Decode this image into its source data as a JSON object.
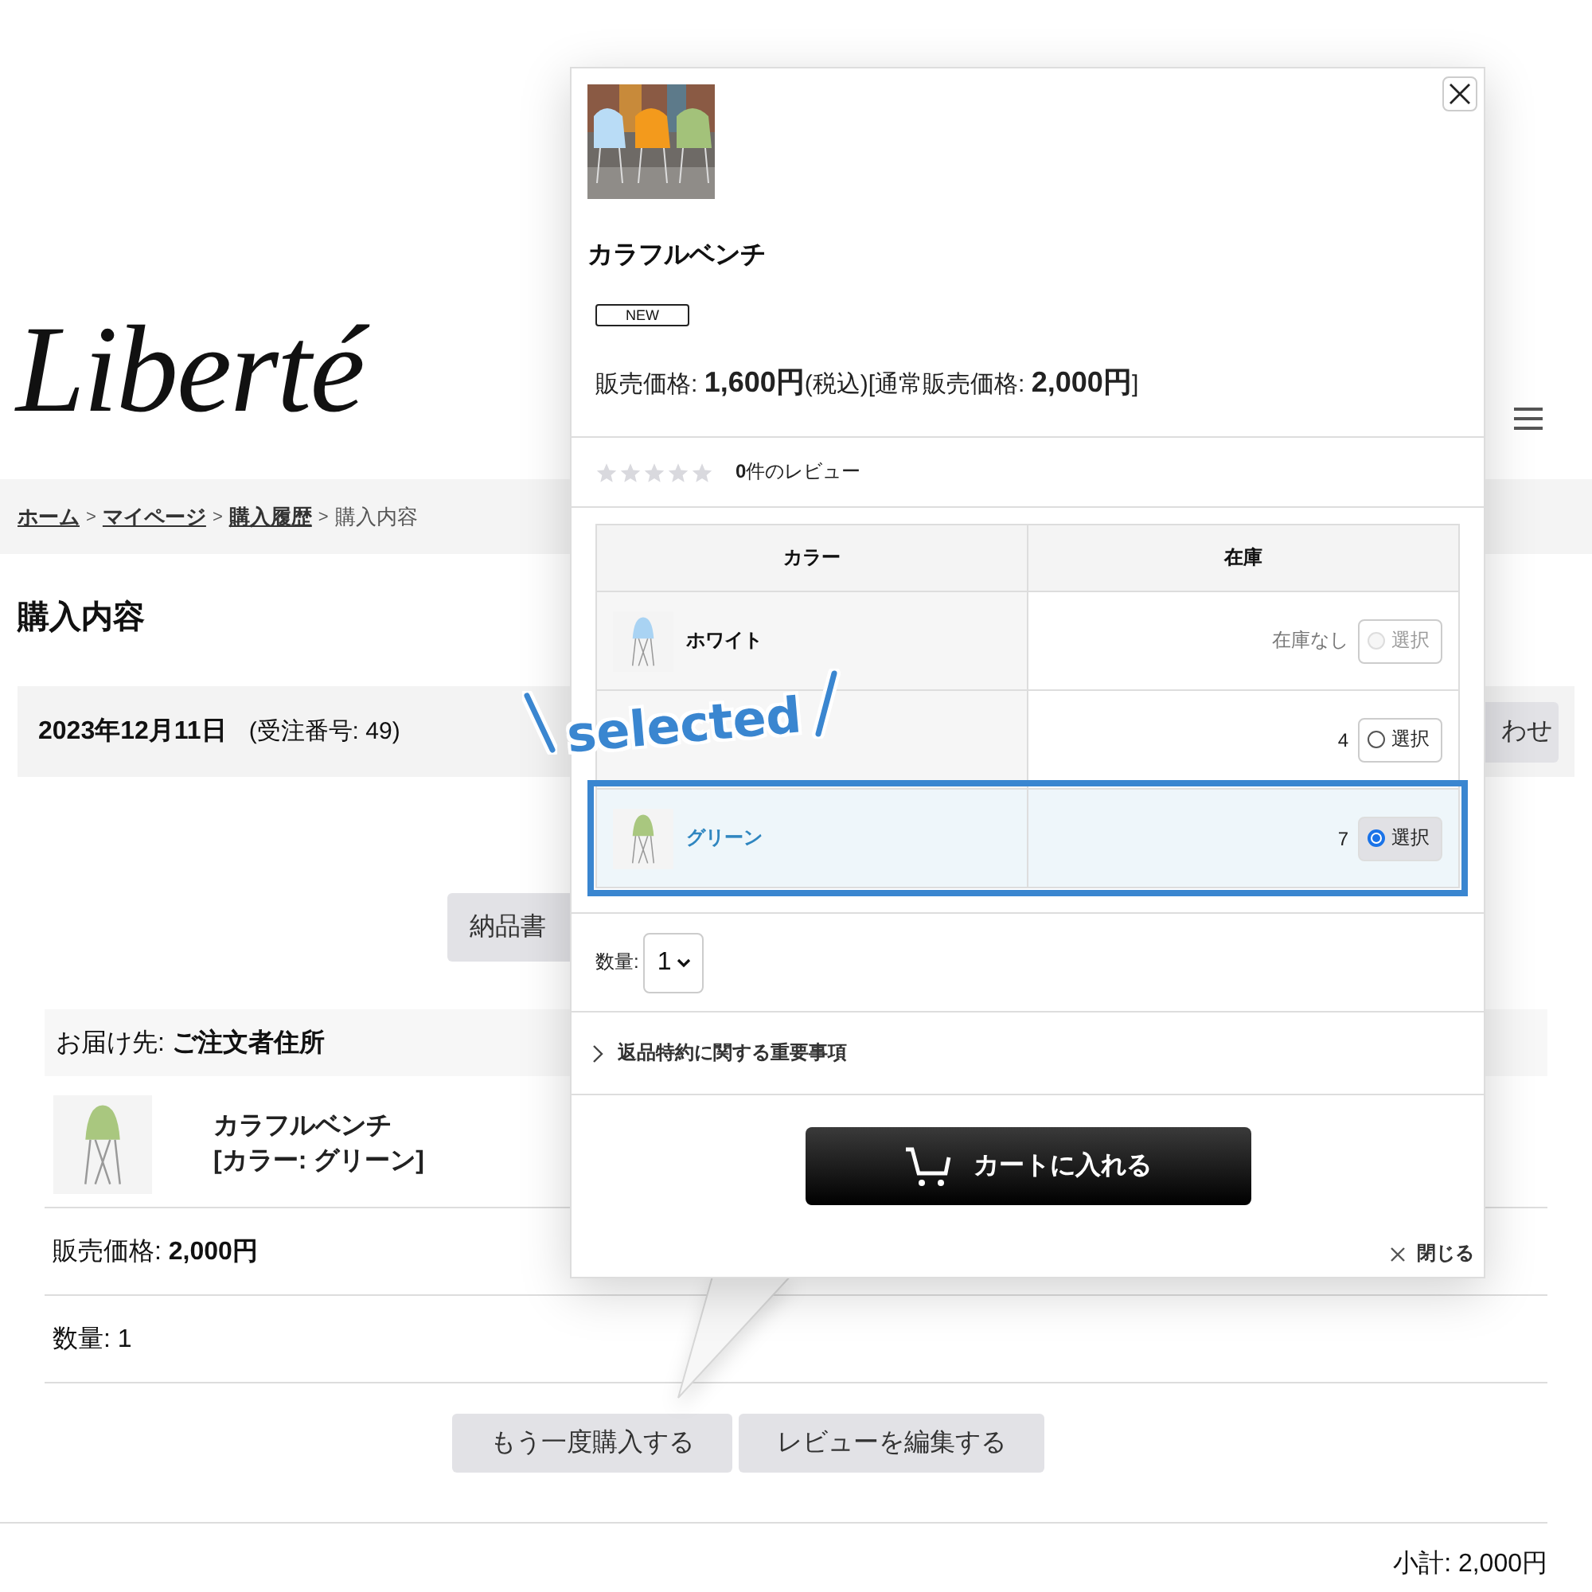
{
  "header": {
    "logo": "Liberté"
  },
  "breadcrumb": [
    {
      "kind": "link",
      "label": "ホーム"
    },
    {
      "kind": "separator",
      "label": ">"
    },
    {
      "kind": "link",
      "label": "マイページ"
    },
    {
      "kind": "separator",
      "label": ">"
    },
    {
      "kind": "link",
      "label": "購入履歴"
    },
    {
      "kind": "separator",
      "label": ">"
    },
    {
      "kind": "current",
      "label": "購入内容"
    }
  ],
  "page_title": "購入内容",
  "order": {
    "date": "2023年12月11日",
    "number": "(受注番号: 49)",
    "button": "わせ"
  },
  "invoice_button": "納品書",
  "delivery": "お届け先: **ご注文者住所**",
  "item": {
    "name": "カラフルベンチ",
    "option": "[カラー: グリーン]",
    "price": "販売価格: **2,000円**",
    "quantity": "数量: 1"
  },
  "actions": [
    "もう一度購入する",
    "レビューを編集する"
  ],
  "subtotal": "小計: 2,000円",
  "popup": {
    "title": "カラフルベンチ",
    "badge": "NEW",
    "price": "販売価格: **1,600円**(税込)[通常販売価格: **2,000円**]",
    "stars": 0,
    "review_count": "**0**件のレビュー",
    "table": {
      "columns": [
        "カラー",
        "在庫"
      ],
      "rows": [
        {
          "name": "ホワイト",
          "stock": "在庫なし",
          "button": "選択",
          "disabled": true,
          "selected": false
        },
        {
          "stock": "4",
          "button": "選択",
          "disabled": false,
          "selected": false
        },
        {
          "name": "グリーン",
          "stock": "7",
          "button": "選択",
          "disabled": false,
          "selected": true
        }
      ]
    },
    "quantity": {
      "label": "数量:",
      "value": "1"
    },
    "accordion": {
      "label": "返品特約に関する重要事項",
      "expanded": false
    },
    "cart_button": "カートに入れる",
    "close_link": "閉じる"
  },
  "annotation": {
    "label": "selected"
  }
}
